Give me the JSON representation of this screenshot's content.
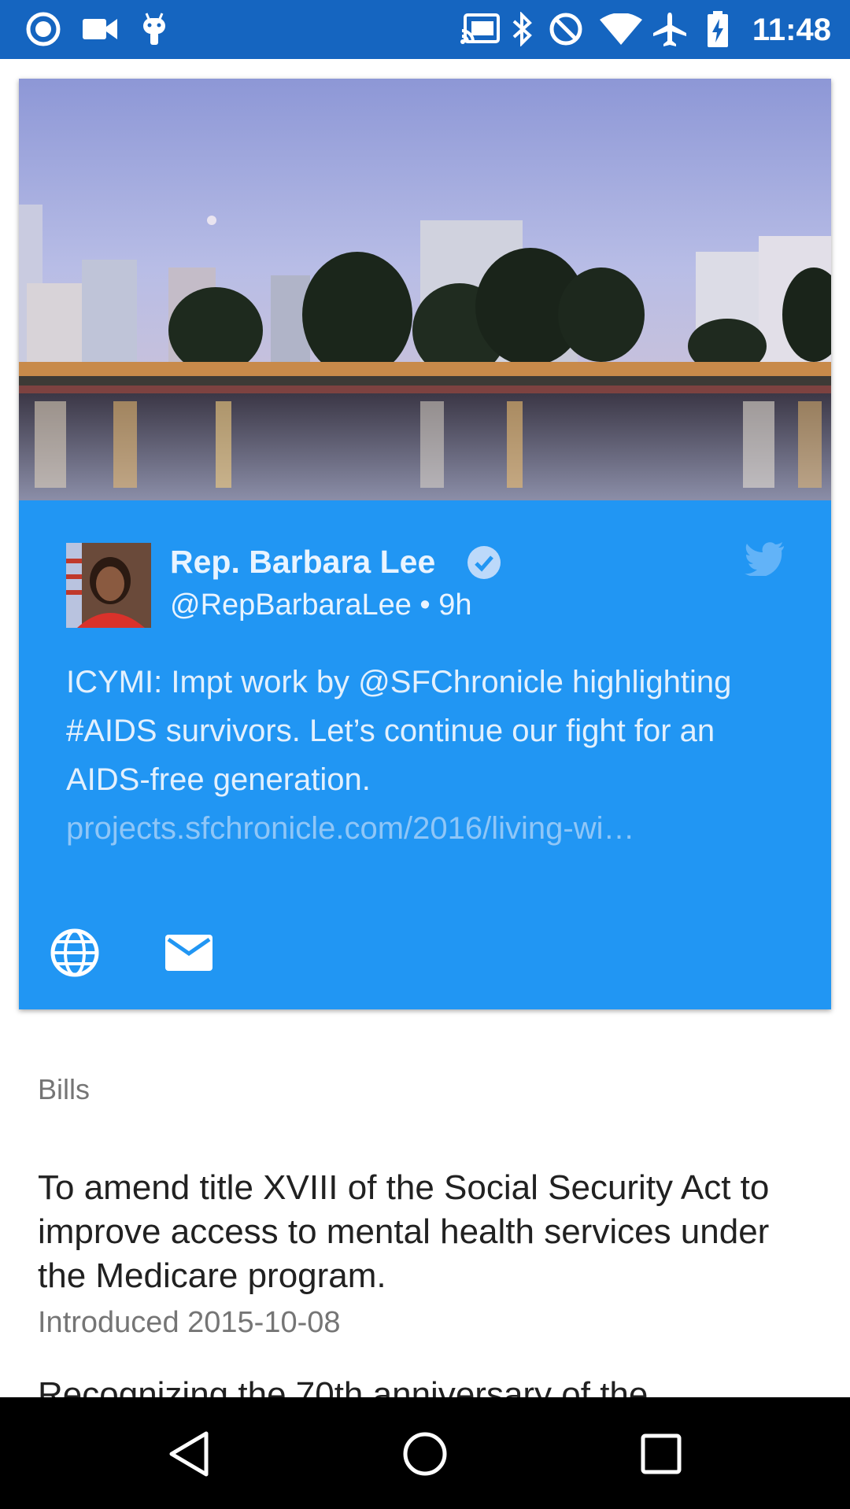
{
  "status_bar": {
    "time": "11:48",
    "left_icons": [
      "record-icon",
      "video-camera-icon",
      "android-debug-icon"
    ],
    "right_icons": [
      "cast-icon",
      "bluetooth-icon",
      "do-not-disturb-icon",
      "wifi-icon",
      "airplane-mode-icon",
      "battery-charging-icon"
    ],
    "background": "#1565c0"
  },
  "tweet_card": {
    "name": "Rep. Barbara Lee",
    "handle": "@RepBarbaraLee • 9h",
    "text": "ICYMI: Impt work by @SFChronicle highlighting #AIDS survivors. Let’s continue our fight for an AIDS-free generation.",
    "link": "projects.sfchronicle.com/2016/living-wi…",
    "accent": "#2196f3",
    "actions": [
      "globe-icon",
      "mail-icon"
    ]
  },
  "bills": {
    "header": "Bills",
    "items": [
      {
        "title": "To amend title XVIII of the Social Security Act to improve access to mental health services under the Medicare program.",
        "date": "Introduced 2015-10-08"
      },
      {
        "title": "Recognizing the 70th anniversary of the"
      }
    ]
  },
  "nav_bar": {
    "buttons": [
      "back-icon",
      "home-icon",
      "recents-icon"
    ]
  }
}
